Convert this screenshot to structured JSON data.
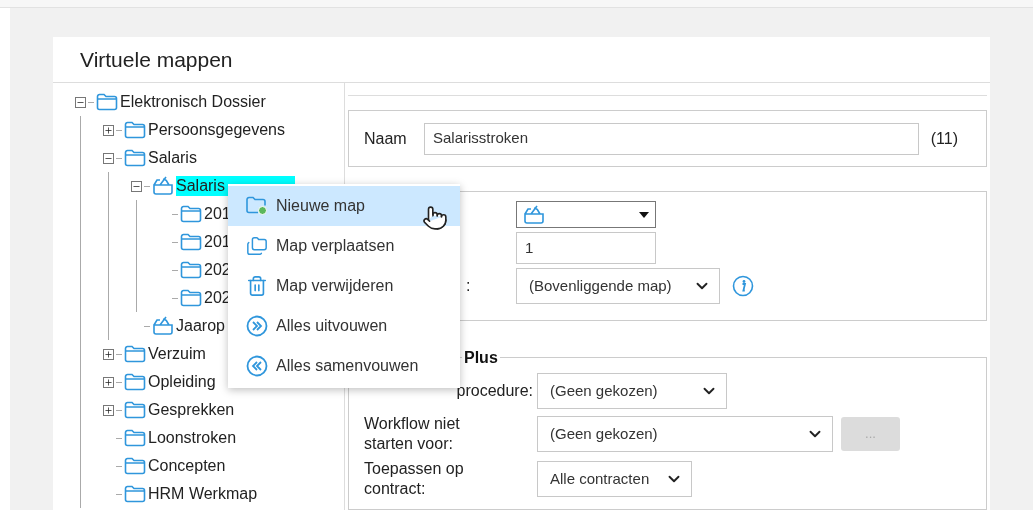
{
  "title": "Virtuele mappen",
  "tree": [
    {
      "label": "Elektronisch Dossier",
      "kind": "folder",
      "expanded": true,
      "selected": false,
      "children": [
        {
          "label": "Persoonsgegevens",
          "kind": "folder",
          "expanded": false,
          "selected": false
        },
        {
          "label": "Salaris",
          "kind": "folder",
          "expanded": true,
          "selected": false,
          "children": [
            {
              "label": "Salaris",
              "kind": "tray",
              "expanded": true,
              "selected": true,
              "children": [
                {
                  "label": "201",
                  "kind": "folder",
                  "selected": false
                },
                {
                  "label": "201",
                  "kind": "folder",
                  "selected": false
                },
                {
                  "label": "202",
                  "kind": "folder",
                  "selected": false
                },
                {
                  "label": "202",
                  "kind": "folder",
                  "selected": false
                }
              ]
            },
            {
              "label": "Jaarop",
              "kind": "tray",
              "selected": false
            }
          ]
        },
        {
          "label": "Verzuim",
          "kind": "folder",
          "expanded": false,
          "selected": false
        },
        {
          "label": "Opleiding",
          "kind": "folder",
          "expanded": false,
          "selected": false
        },
        {
          "label": "Gesprekken",
          "kind": "folder",
          "expanded": false,
          "selected": false
        },
        {
          "label": "Loonstroken",
          "kind": "folder",
          "selected": false
        },
        {
          "label": "Concepten",
          "kind": "folder",
          "selected": false
        },
        {
          "label": "HRM Werkmap",
          "kind": "folder",
          "selected": false
        }
      ]
    }
  ],
  "context_menu": [
    {
      "label": "Nieuwe map",
      "kind": "new-folder",
      "selected": true
    },
    {
      "label": "Map verplaatsen",
      "kind": "move",
      "selected": false
    },
    {
      "label": "Map verwijderen",
      "kind": "delete",
      "selected": false
    },
    {
      "label": "Alles uitvouwen",
      "kind": "expand",
      "selected": false
    },
    {
      "label": "Alles samenvouwen",
      "kind": "collapse",
      "selected": false
    }
  ],
  "name_section": {
    "label": "Naam",
    "value": "Salarisstroken",
    "count": "(11)"
  },
  "settings_section": {
    "order_value": "1",
    "parent_label": ":",
    "parent_select": "(Bovenliggende map)"
  },
  "plus_section": {
    "legend": "Plus",
    "rows": [
      {
        "label": "procedure:",
        "value": "(Geen gekozen)"
      },
      {
        "label": "Workflow niet starten voor:",
        "value": "(Geen gekozen)",
        "button": "..."
      },
      {
        "label": "Toepassen op contract:",
        "value": "Alle contracten"
      }
    ]
  }
}
